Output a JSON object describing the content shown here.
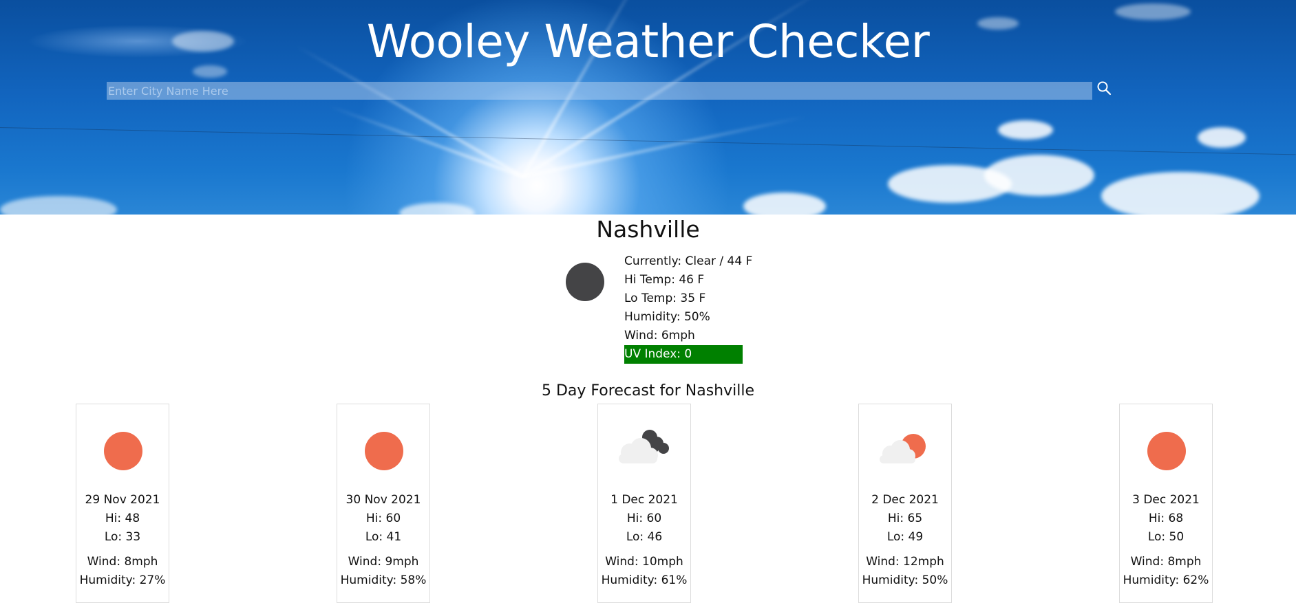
{
  "header": {
    "title": "Wooley Weather Checker",
    "search_placeholder": "Enter City Name Here",
    "search_icon": "search-icon"
  },
  "current": {
    "city": "Nashville",
    "icon": "moon-icon",
    "currently": "Currently: Clear / 44 F",
    "hi_temp": "Hi Temp: 46 F",
    "lo_temp": "Lo Temp: 35 F",
    "humidity": "Humidity: 50%",
    "wind": "Wind: 6mph",
    "uv_index": "UV Index: 0",
    "uv_color": "#008000"
  },
  "forecast": {
    "title": "5 Day Forecast for Nashville",
    "days": [
      {
        "icon": "sun-icon",
        "date": "29 Nov 2021",
        "hi": "Hi: 48",
        "lo": "Lo: 33",
        "wind": "Wind: 8mph",
        "humidity": "Humidity: 27%"
      },
      {
        "icon": "sun-icon",
        "date": "30 Nov 2021",
        "hi": "Hi: 60",
        "lo": "Lo: 41",
        "wind": "Wind: 9mph",
        "humidity": "Humidity: 58%"
      },
      {
        "icon": "clouds-icon",
        "date": "1 Dec 2021",
        "hi": "Hi: 60",
        "lo": "Lo: 46",
        "wind": "Wind: 10mph",
        "humidity": "Humidity: 61%"
      },
      {
        "icon": "partly-cloudy-icon",
        "date": "2 Dec 2021",
        "hi": "Hi: 65",
        "lo": "Lo: 49",
        "wind": "Wind: 12mph",
        "humidity": "Humidity: 50%"
      },
      {
        "icon": "sun-icon",
        "date": "3 Dec 2021",
        "hi": "Hi: 68",
        "lo": "Lo: 50",
        "wind": "Wind: 8mph",
        "humidity": "Humidity: 62%"
      }
    ]
  },
  "colors": {
    "sun": "#ef6c4d",
    "moon": "#444446",
    "cloud_light": "#f0f0f0",
    "cloud_dark": "#444446"
  }
}
